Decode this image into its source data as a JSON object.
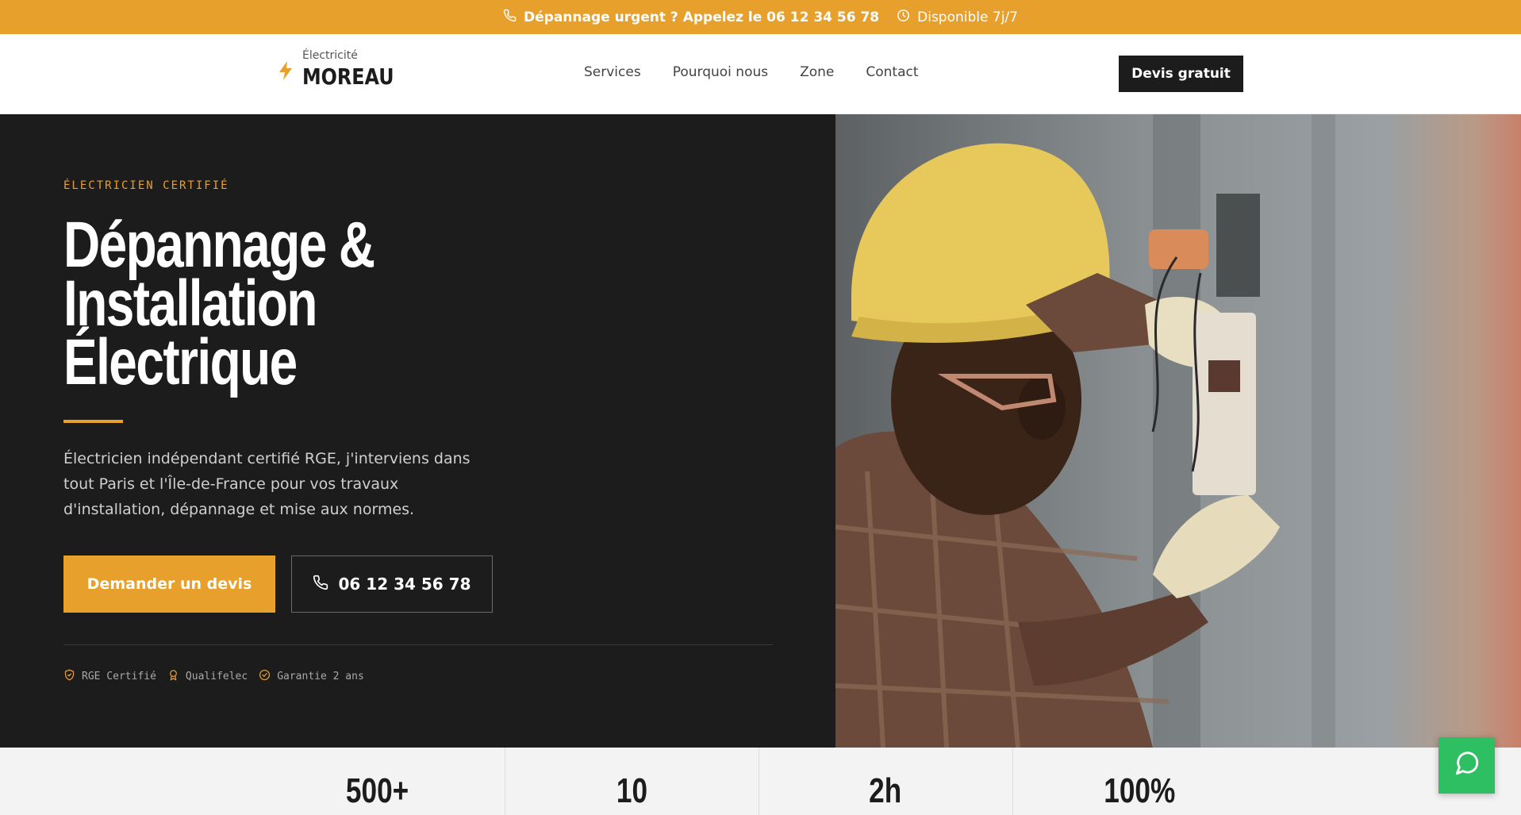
{
  "topbar": {
    "urgent_text": "Dépannage urgent ? Appelez le 06 12 34 56 78",
    "availability_text": "Disponible 7j/7",
    "icons": [
      "phone-icon",
      "clock-icon"
    ]
  },
  "header": {
    "logo_sub": "Électricité",
    "logo_name": "MOREAU",
    "logo_icon": "bolt-icon",
    "nav": [
      "Services",
      "Pourquoi nous",
      "Zone",
      "Contact"
    ],
    "cta": "Devis gratuit"
  },
  "hero": {
    "eyebrow": "ÉLECTRICIEN CERTIFIÉ",
    "title_lines": [
      "Dépannage &",
      "Installation",
      "Électrique"
    ],
    "description": "Électricien indépendant certifié RGE, j'interviens dans tout Paris et l'Île-de-France pour vos travaux d'installation, dépannage et mise aux normes.",
    "primary_cta": "Demander un devis",
    "phone_cta": "06 12 34 56 78",
    "badges": [
      {
        "label": "RGE Certifié",
        "icon": "shield-icon"
      },
      {
        "label": "Qualifelec",
        "icon": "award-icon"
      },
      {
        "label": "Garantie 2 ans",
        "icon": "check-circle-icon"
      }
    ]
  },
  "stats": [
    "500+",
    "10",
    "2h",
    "100%"
  ],
  "colors": {
    "accent": "#e8a02c",
    "dark": "#1c1c1c",
    "chat": "#2fbf63"
  }
}
